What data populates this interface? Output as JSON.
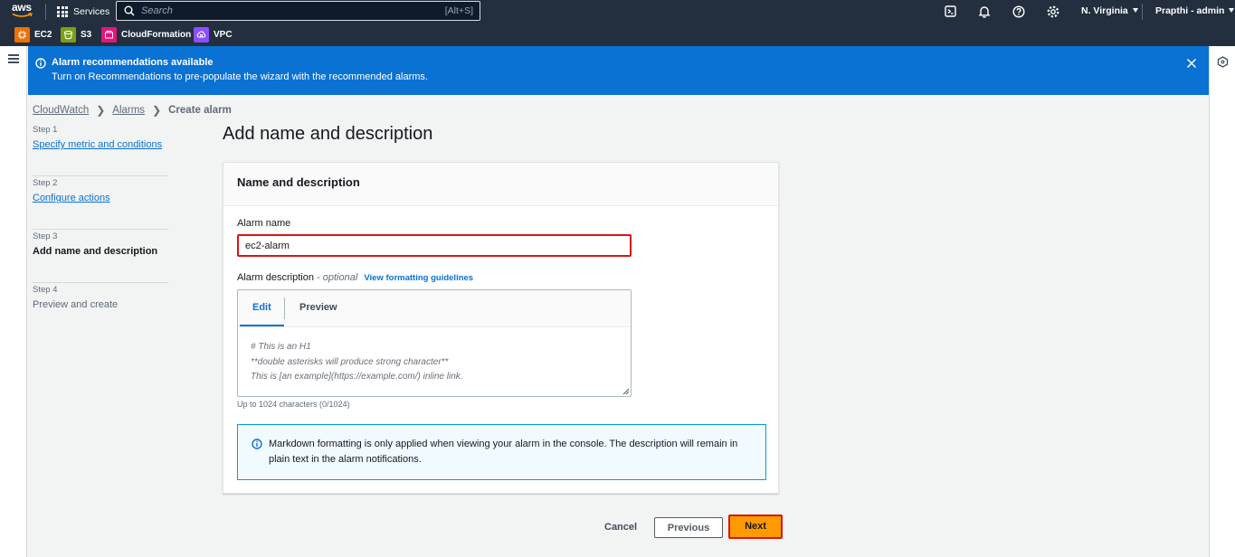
{
  "topnav": {
    "logo_text": "aws",
    "services_label": "Services",
    "search_placeholder": "Search",
    "search_shortcut": "[Alt+S]",
    "region": "N. Virginia",
    "account": "Prapthi - admin",
    "icons": [
      "cloudshell-icon",
      "notifications-icon",
      "help-icon",
      "settings-icon"
    ]
  },
  "favorites": [
    {
      "label": "EC2",
      "color": "#ed7100"
    },
    {
      "label": "S3",
      "color": "#7aa116"
    },
    {
      "label": "CloudFormation",
      "color": "#e7157b"
    },
    {
      "label": "VPC",
      "color": "#8c4fff"
    }
  ],
  "flash": {
    "title": "Alarm recommendations available",
    "message": "Turn on Recommendations to pre-populate the wizard with the recommended alarms.",
    "color": "#0972d3"
  },
  "breadcrumbs": [
    "CloudWatch",
    "Alarms",
    "Create alarm"
  ],
  "steps": [
    {
      "num": "Step 1",
      "label": "Specify metric and conditions",
      "state": "link"
    },
    {
      "num": "Step 2",
      "label": "Configure actions",
      "state": "link"
    },
    {
      "num": "Step 3",
      "label": "Add name and description",
      "state": "active"
    },
    {
      "num": "Step 4",
      "label": "Preview and create",
      "state": "disabled"
    }
  ],
  "main": {
    "page_title": "Add name and description",
    "card_title": "Name and description",
    "alarm_name_label": "Alarm name",
    "alarm_name_value": "ec2-alarm",
    "description_label": "Alarm description",
    "description_optional": "- optional",
    "formatting_link": "View formatting guidelines",
    "tabs": [
      "Edit",
      "Preview"
    ],
    "description_placeholder_lines": [
      "# This is an H1",
      "**double asterisks will produce strong character**",
      "This is [an example](https://example.com/) inline link."
    ],
    "constraint": "Up to 1024 characters (0/1024)",
    "info_text": "Markdown formatting is only applied when viewing your alarm in the console. The description will remain in plain text in the alarm notifications."
  },
  "footer": {
    "cancel": "Cancel",
    "previous": "Previous",
    "next": "Next"
  },
  "colors": {
    "nav_bg": "#232f3e",
    "link": "#0972d3",
    "primary": "#ff9900",
    "highlight_border": "#d91515"
  }
}
